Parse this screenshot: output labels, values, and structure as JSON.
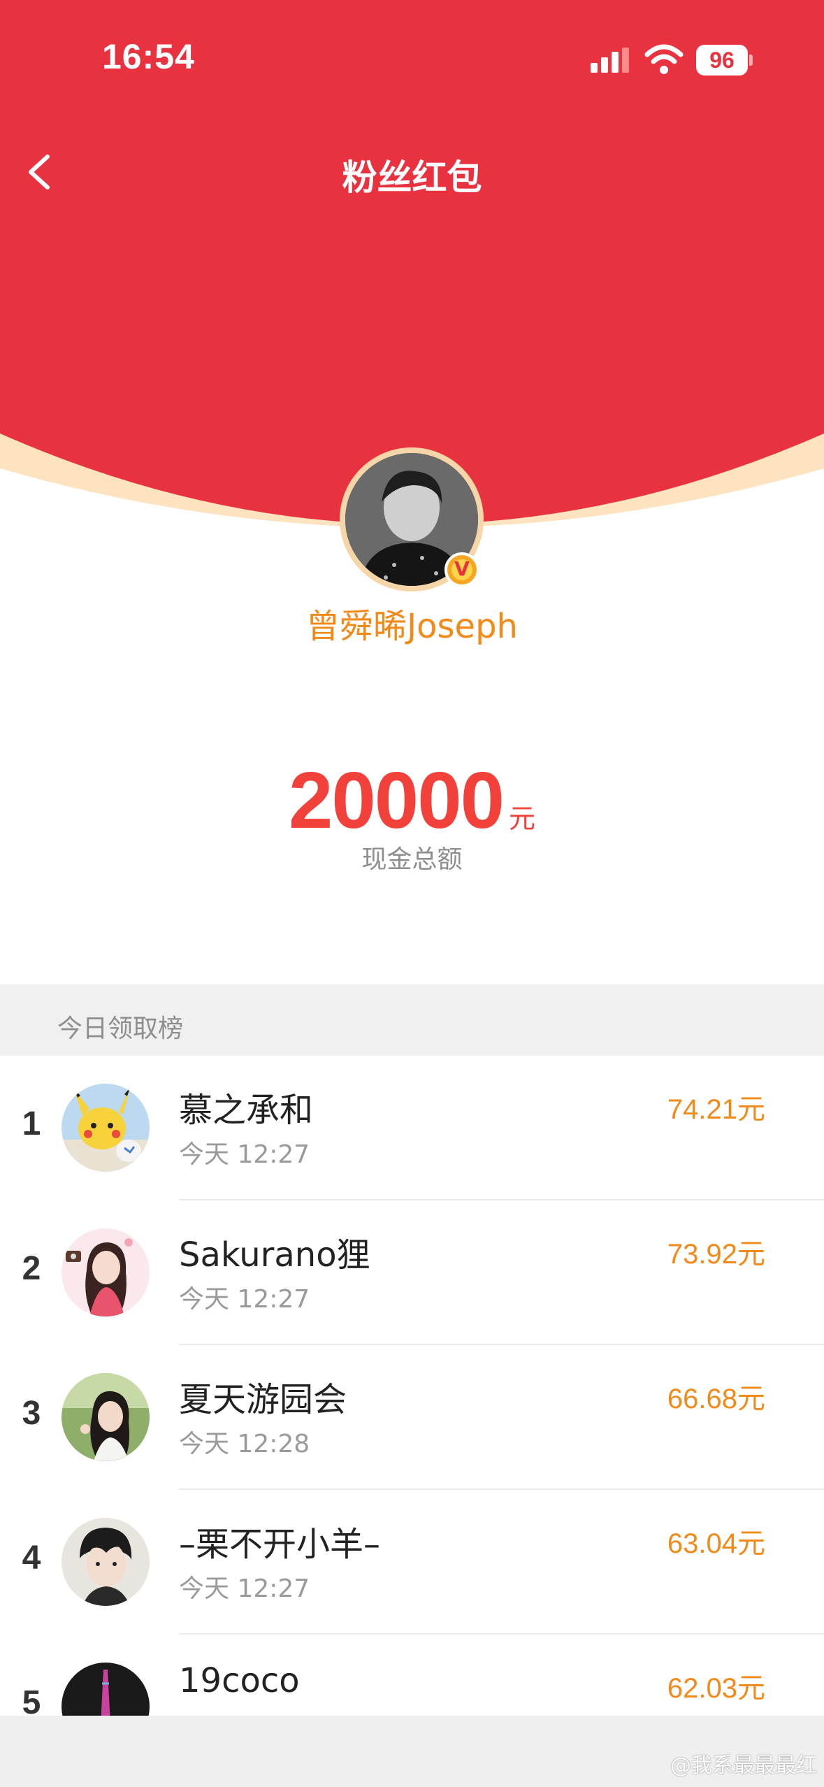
{
  "status_bar": {
    "time": "16:54",
    "battery": "96"
  },
  "header": {
    "title": "粉丝红包"
  },
  "creator": {
    "name": "曾舜晞Joseph",
    "badge": "V"
  },
  "total": {
    "amount": "20000",
    "unit": "元",
    "label": "现金总额"
  },
  "leaderboard": {
    "title": "今日领取榜",
    "rows": [
      {
        "rank": "1",
        "name": "慕之承和",
        "time": "今天 12:27",
        "amount": "74.21",
        "unit": "元"
      },
      {
        "rank": "2",
        "name": "Sakurano狸",
        "time": "今天 12:27",
        "amount": "73.92",
        "unit": "元"
      },
      {
        "rank": "3",
        "name": "夏天游园会",
        "time": "今天 12:28",
        "amount": "66.68",
        "unit": "元"
      },
      {
        "rank": "4",
        "name": "–栗不开小羊–",
        "time": "今天 12:27",
        "amount": "63.04",
        "unit": "元"
      },
      {
        "rank": "5",
        "name": "19coco",
        "time": "",
        "amount": "62.03",
        "unit": "元"
      }
    ]
  },
  "watermark": "@我系最最最红",
  "colors": {
    "header_red": "#e8323f",
    "accent_orange": "#f28a1a",
    "amount_red": "#f2403a"
  }
}
